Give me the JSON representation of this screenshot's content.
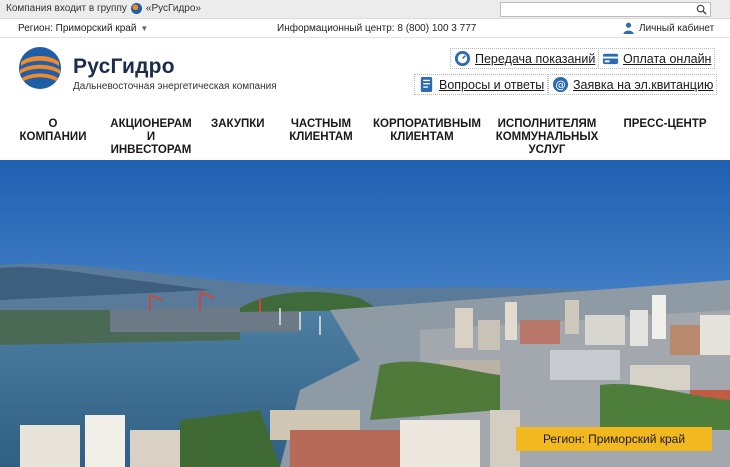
{
  "topbar": {
    "group_text": "Компания входит в группу",
    "group_name": "«РусГидро»",
    "search_placeholder": ""
  },
  "infoline": {
    "region_label": "Регион: Приморский край",
    "info_center": "Информационный центр: 8 (800) 100 3 777",
    "cabinet_label": "Личный кабинет"
  },
  "brand": {
    "name": "РусГидро",
    "tagline": "Дальневосточная энергетическая компания"
  },
  "quick_links": {
    "meter": "Передача показаний",
    "pay": "Оплата онлайн",
    "faq": "Вопросы и ответы",
    "ereceipt": "Заявка на эл.квитанцию"
  },
  "nav": {
    "about": "О КОМПАНИИ",
    "investors_1": "АКЦИОНЕРАМ",
    "investors_2": "И ИНВЕСТОРАМ",
    "purchases": "ЗАКУПКИ",
    "private_1": "ЧАСТНЫМ",
    "private_2": "КЛИЕНТАМ",
    "corporate_1": "КОРПОРАТИВНЫМ",
    "corporate_2": "КЛИЕНТАМ",
    "providers_1": "ИСПОЛНИТЕЛЯМ",
    "providers_2": "КОММУНАЛЬНЫХ УСЛУГ",
    "press": "ПРЕСС-ЦЕНТР"
  },
  "hero": {
    "region_badge": "Регион: Приморский край"
  },
  "colors": {
    "brand_blue": "#1e5fa8",
    "brand_orange": "#f08a2a",
    "badge_yellow": "#f1b81f"
  }
}
